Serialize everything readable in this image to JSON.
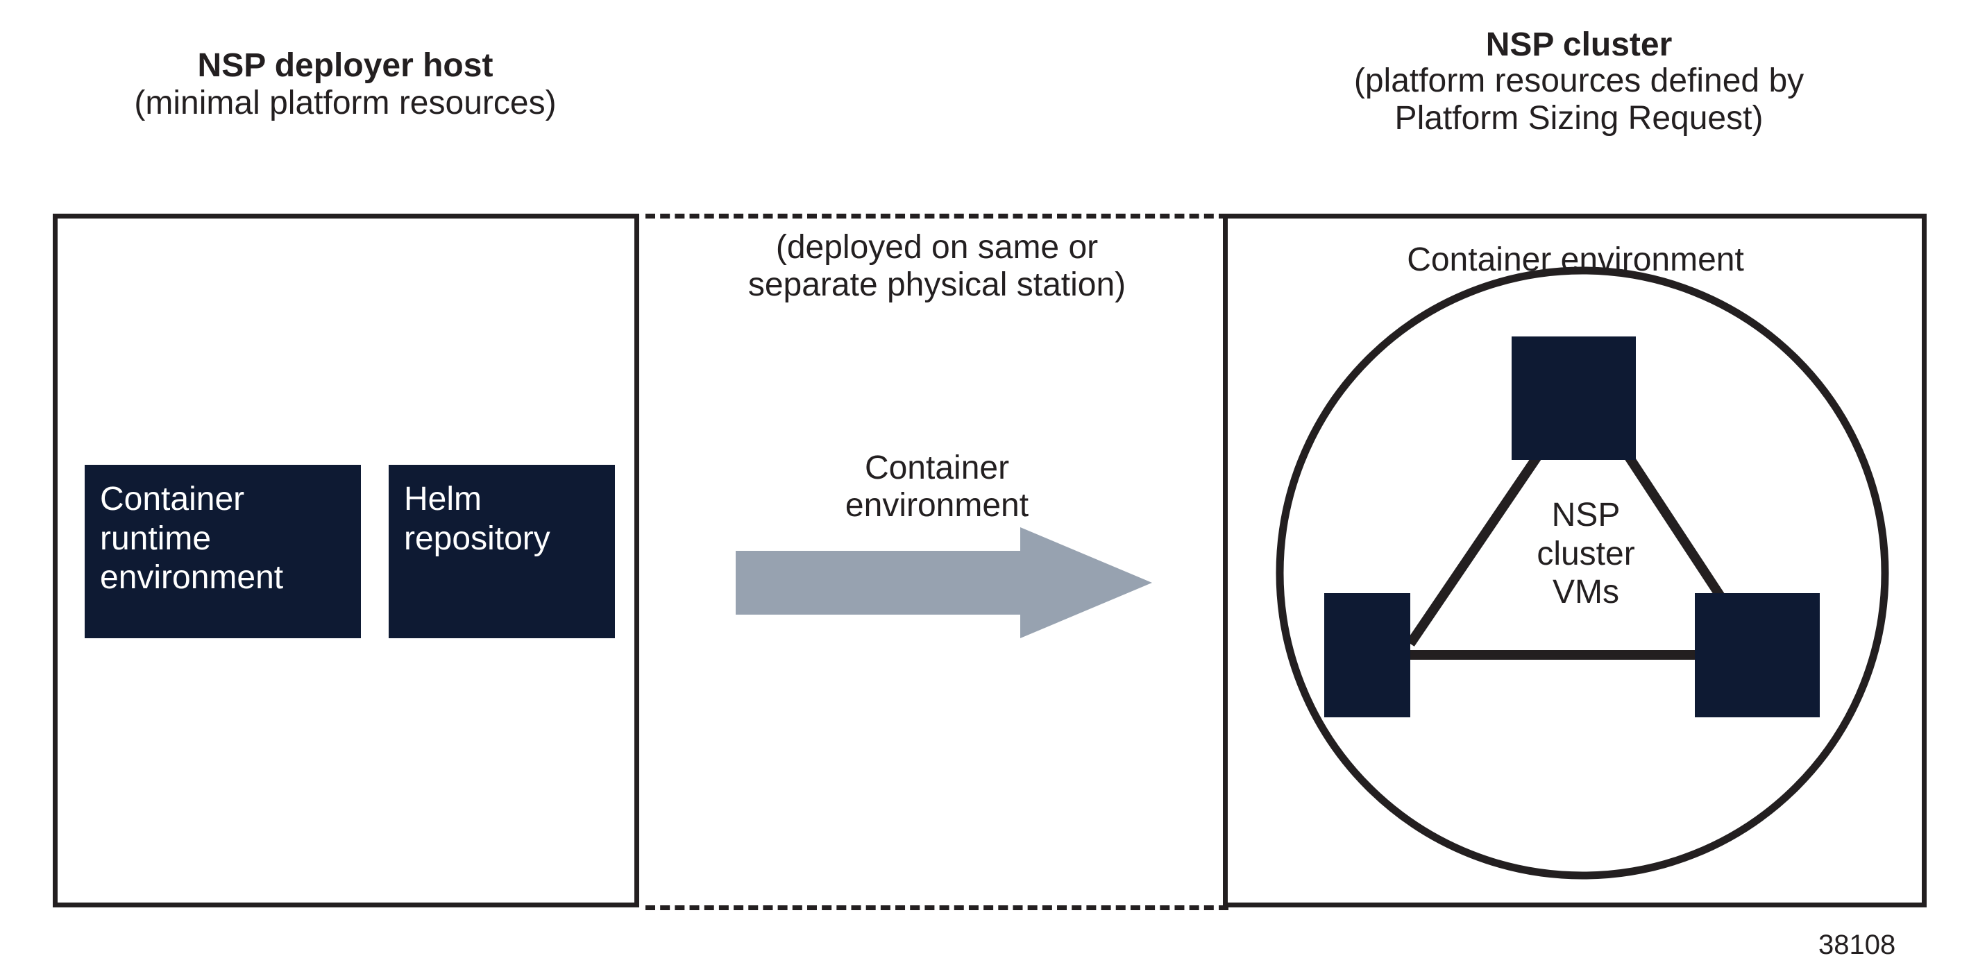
{
  "diagram": {
    "figure_id": "38108",
    "colors": {
      "box_fill": "#0e1a33",
      "line": "#231f20",
      "arrow": "#97a2b0",
      "background": "#ffffff",
      "box_text": "#ffffff"
    },
    "deployer": {
      "title": "NSP deployer host",
      "subtitle": "(minimal platform resources)",
      "boxes": [
        {
          "label": "Container\nruntime\nenvironment"
        },
        {
          "label": "Helm\nrepository"
        }
      ]
    },
    "middle": {
      "note": "(deployed on same or\nseparate physical station)",
      "arrow_label": "Container\nenvironment",
      "arrow_direction": "right"
    },
    "cluster": {
      "title": "NSP cluster",
      "subtitle": "(platform resources defined by\nPlatform Sizing Request)",
      "environment_label": "Container environment",
      "vm_group_label": "NSP\ncluster\nVMs",
      "vm_count": 3
    }
  }
}
